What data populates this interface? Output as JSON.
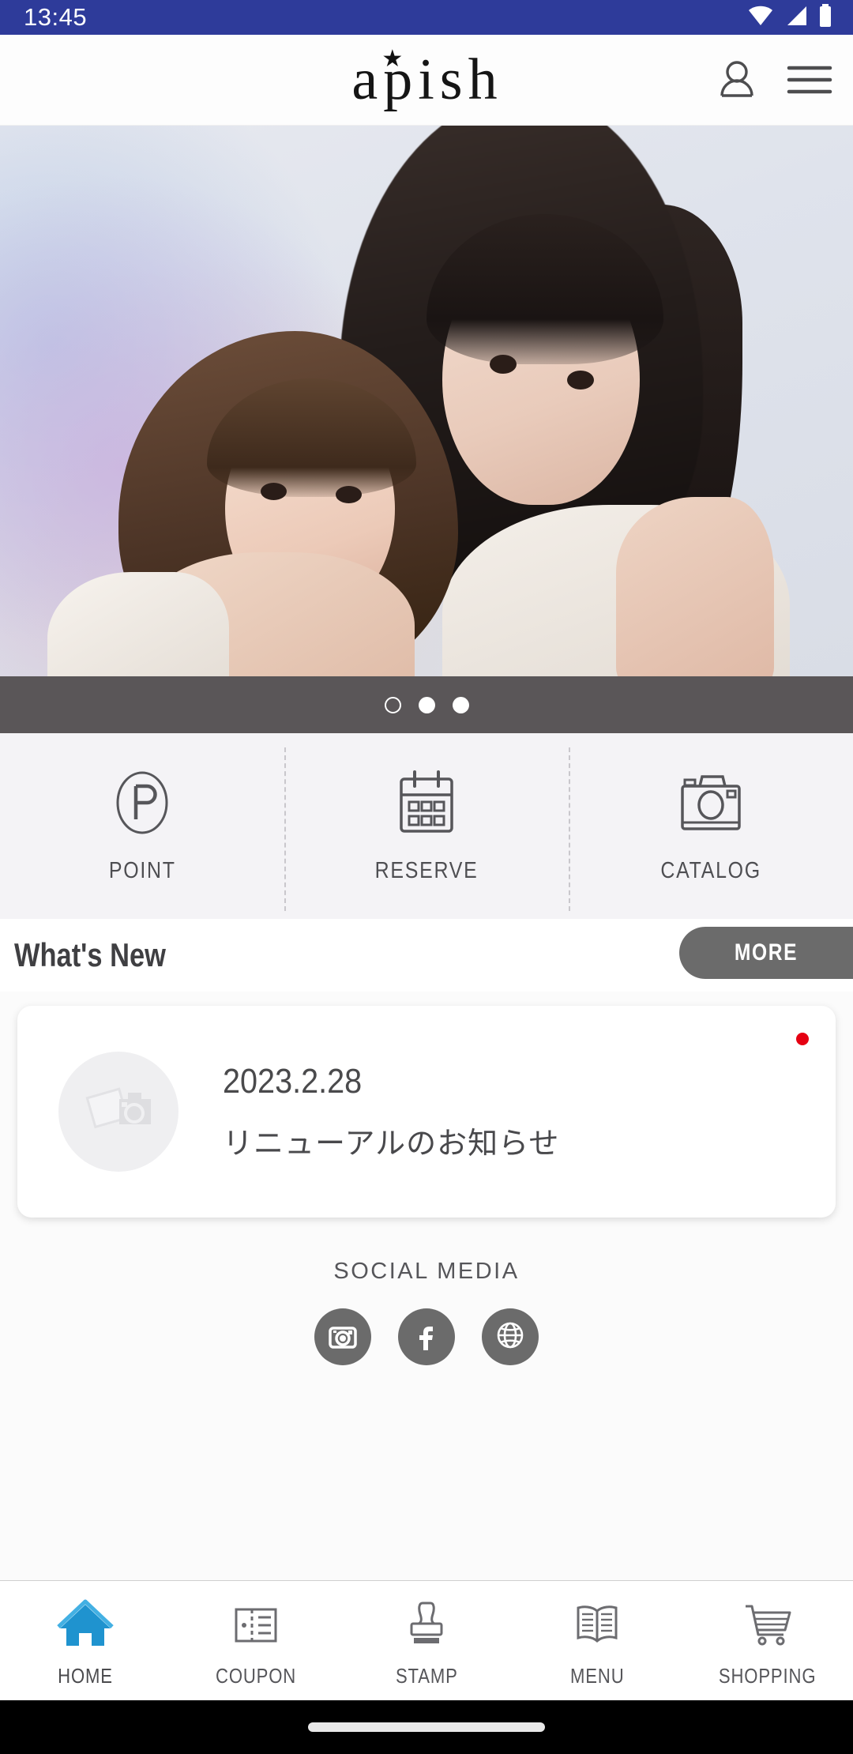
{
  "status_bar": {
    "time": "13:45",
    "icons": [
      "wifi-icon",
      "signal-icon",
      "battery-icon"
    ],
    "background": "#2e3b9a"
  },
  "header": {
    "logo_text": "apish",
    "logo_star": "★",
    "account_icon": "person-icon",
    "menu_icon": "hamburger-menu-icon"
  },
  "hero": {
    "alt": "two women hair style photo",
    "carousel": {
      "dots": 3,
      "active_index": 0,
      "bar_color": "#5a5658"
    }
  },
  "quick_actions": [
    {
      "label": "POINT",
      "icon": "point-circle-p-icon"
    },
    {
      "label": "RESERVE",
      "icon": "calendar-icon"
    },
    {
      "label": "CATALOG",
      "icon": "camera-icon"
    }
  ],
  "whats_new": {
    "title": "What's New",
    "more_label": "MORE",
    "more_color": "#6b6b6b",
    "items": [
      {
        "date": "2023.2.28",
        "title": "リニューアルのお知らせ",
        "thumbnail": "photo-placeholder-icon",
        "unread": true,
        "badge_color": "#e50012"
      }
    ]
  },
  "social_media": {
    "title": "SOCIAL MEDIA",
    "items": [
      {
        "name": "instagram",
        "icon": "instagram-icon"
      },
      {
        "name": "facebook",
        "icon": "facebook-icon"
      },
      {
        "name": "website",
        "icon": "globe-icon"
      }
    ],
    "circle_color": "#6b6b6b"
  },
  "bottom_nav": {
    "active_color": "#1f93cf",
    "items": [
      {
        "label": "HOME",
        "icon": "home-icon",
        "active": true
      },
      {
        "label": "COUPON",
        "icon": "coupon-icon",
        "active": false
      },
      {
        "label": "STAMP",
        "icon": "stamp-icon",
        "active": false
      },
      {
        "label": "MENU",
        "icon": "book-menu-icon",
        "active": false
      },
      {
        "label": "SHOPPING",
        "icon": "cart-icon",
        "active": false
      }
    ]
  },
  "system_nav": {
    "home_indicator": true
  }
}
